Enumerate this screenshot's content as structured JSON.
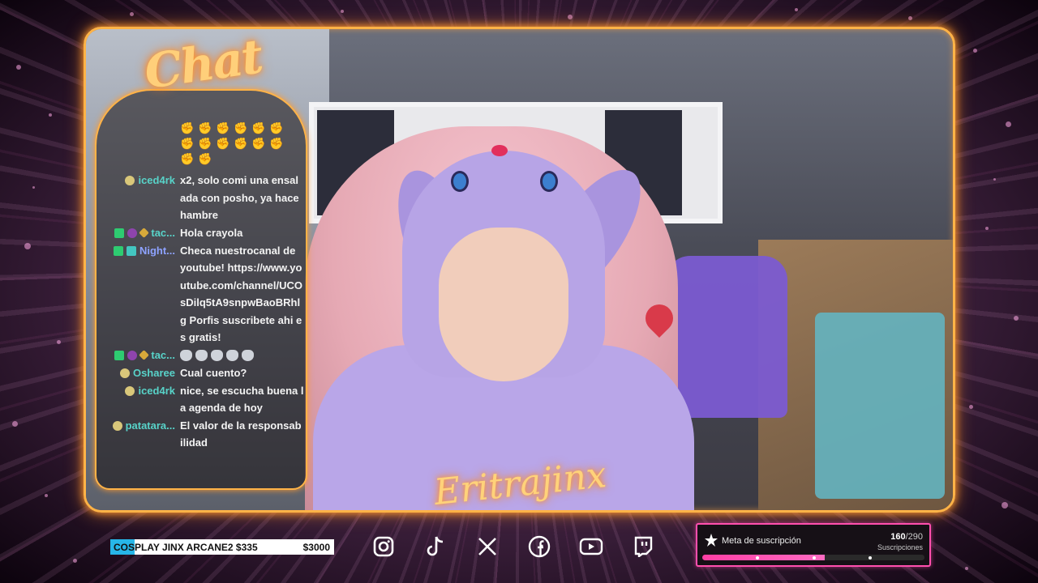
{
  "chat": {
    "title": "Chat",
    "emote_row_count": 14,
    "messages": [
      {
        "user": "iced4rk",
        "user_color": "#58d3c9",
        "badges": [
          "avatar"
        ],
        "text": "x2, solo comi una ensalada con posho, ya hace hambre"
      },
      {
        "user": "tac...",
        "user_color": "#58d3c9",
        "badges": [
          "green",
          "purple",
          "gold"
        ],
        "text": "Hola crayola"
      },
      {
        "user": "Night...",
        "user_color": "#8ea2ff",
        "badges": [
          "green",
          "teal"
        ],
        "text": "Checa nuestrocanal de youtube! https://www.youtube.com/channel/UCOsDilq5tA9snpwBaoBRhlg Porfis suscribete ahi es gratis!"
      },
      {
        "user": "tac...",
        "user_color": "#58d3c9",
        "badges": [
          "green",
          "purple",
          "gold"
        ],
        "text": "",
        "emotes": 5
      },
      {
        "user": "Osharee",
        "user_color": "#58d3c9",
        "badges": [
          "avatar"
        ],
        "text": "Cual cuento?"
      },
      {
        "user": "iced4rk",
        "user_color": "#58d3c9",
        "badges": [
          "avatar"
        ],
        "text": "nice, se escucha buena la agenda de hoy"
      },
      {
        "user": "patatara...",
        "user_color": "#58d3c9",
        "badges": [
          "avatar"
        ],
        "text": "El valor de la responsabilidad"
      }
    ]
  },
  "signature": "Eritrajinx",
  "goal": {
    "label": "COSPLAY JINX ARCANE2 $335",
    "target": "$3000",
    "progress": 0.11,
    "accent": "#27b6e8"
  },
  "socials": [
    {
      "name": "instagram"
    },
    {
      "name": "tiktok"
    },
    {
      "name": "x"
    },
    {
      "name": "facebook"
    },
    {
      "name": "youtube"
    },
    {
      "name": "twitch"
    }
  ],
  "subs": {
    "title": "Meta de suscripción",
    "current": "160",
    "total": "/290",
    "unit": "Suscripciones",
    "progress": 0.552,
    "accent": "#ff4fae"
  }
}
